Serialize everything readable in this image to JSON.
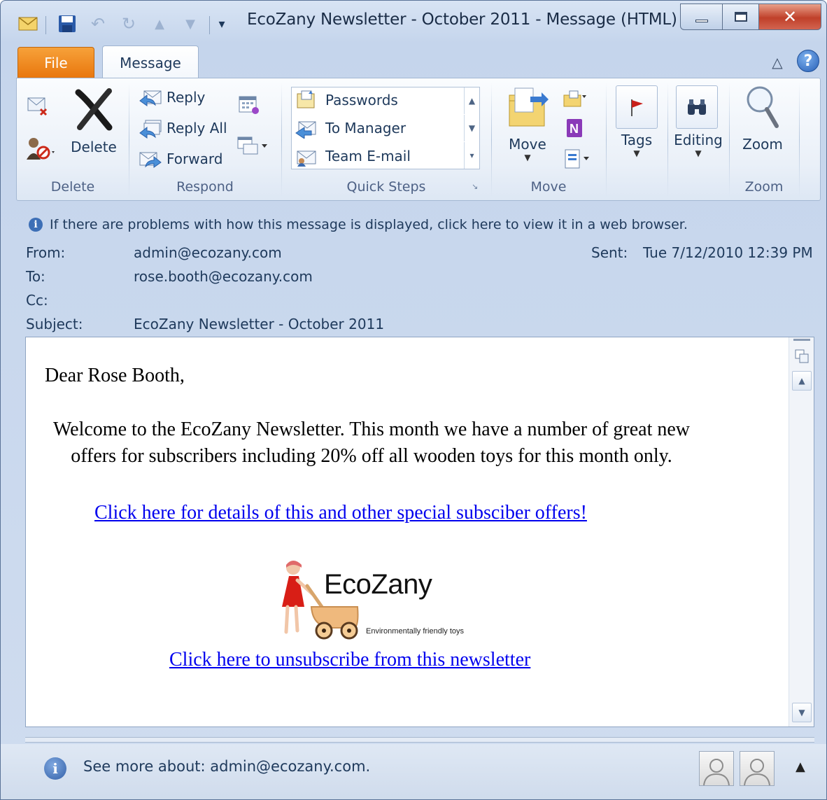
{
  "window": {
    "title": "EcoZany Newsletter - October 2011  -  Message (HTML)"
  },
  "tabs": {
    "file": "File",
    "message": "Message"
  },
  "ribbon": {
    "delete_group": {
      "delete_label": "Delete",
      "group_label": "Delete"
    },
    "respond_group": {
      "reply": "Reply",
      "reply_all": "Reply All",
      "forward": "Forward",
      "group_label": "Respond"
    },
    "quick_steps": {
      "items": [
        "Passwords",
        "To Manager",
        "Team E-mail"
      ],
      "group_label": "Quick Steps"
    },
    "move_group": {
      "move_label": "Move",
      "group_label": "Move"
    },
    "tags_label": "Tags",
    "editing_label": "Editing",
    "zoom_group": {
      "zoom_label": "Zoom",
      "group_label": "Zoom"
    }
  },
  "info_bar": "If there are problems with how this message is displayed, click here to view it in a web browser.",
  "header": {
    "from_label": "From:",
    "from": "admin@ecozany.com",
    "to_label": "To:",
    "to": "rose.booth@ecozany.com",
    "cc_label": "Cc:",
    "cc": "",
    "subject_label": "Subject:",
    "subject": "EcoZany Newsletter - October 2011",
    "sent_label": "Sent:",
    "sent": "Tue 7/12/2010 12:39 PM"
  },
  "body": {
    "greeting": "Dear Rose Booth,",
    "welcome": "Welcome to the EcoZany Newsletter.  This month we have a number of great new offers for subscribers including 20% off all wooden toys for this month only.",
    "offers_link": "Click here for details of this and other special subsciber offers!",
    "logo_brand": "EcoZany",
    "logo_tagline": "Environmentally friendly toys",
    "unsubscribe_link": "Click here to unsubscribe from this newsletter"
  },
  "people_pane": {
    "text": "See more about: admin@ecozany.com."
  },
  "colors": {
    "file_tab": "#e8760c",
    "link": "#0000ee",
    "chrome_blue": "#c5d5ec",
    "close_red": "#c0402a"
  }
}
